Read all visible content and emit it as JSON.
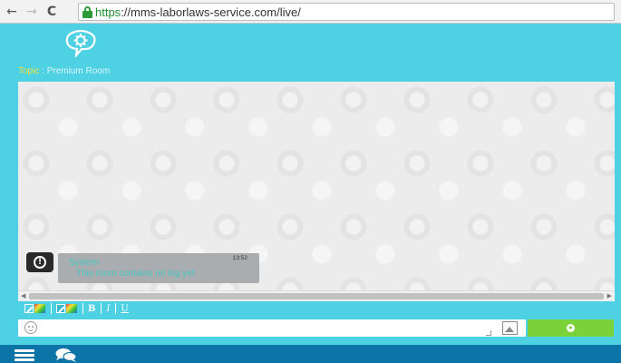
{
  "browser": {
    "url_scheme": "https",
    "url_rest": "://mms-laborlaws-service.com/live/"
  },
  "topic": {
    "label": "Topic",
    "separator": " : ",
    "value": "Premium Room"
  },
  "message": {
    "sender": "System",
    "time": "13:52",
    "text": "This room contains no log yet"
  },
  "toolbar": {
    "bold": "B",
    "italic": "I",
    "underline": "U"
  },
  "colors": {
    "accent": "#4fd1e4",
    "nav": "#0c74a6",
    "send": "#7ad23a",
    "topic_key": "#f5df3a",
    "message_text": "#46c7c0"
  },
  "icons": [
    "back-icon",
    "forward-icon",
    "reload-icon",
    "lock-icon",
    "logo-icon",
    "alert-icon",
    "pencil-icon",
    "color-palette-icon",
    "smiley-icon",
    "image-icon",
    "send-icon",
    "hamburger-icon",
    "chat-bubbles-icon"
  ]
}
